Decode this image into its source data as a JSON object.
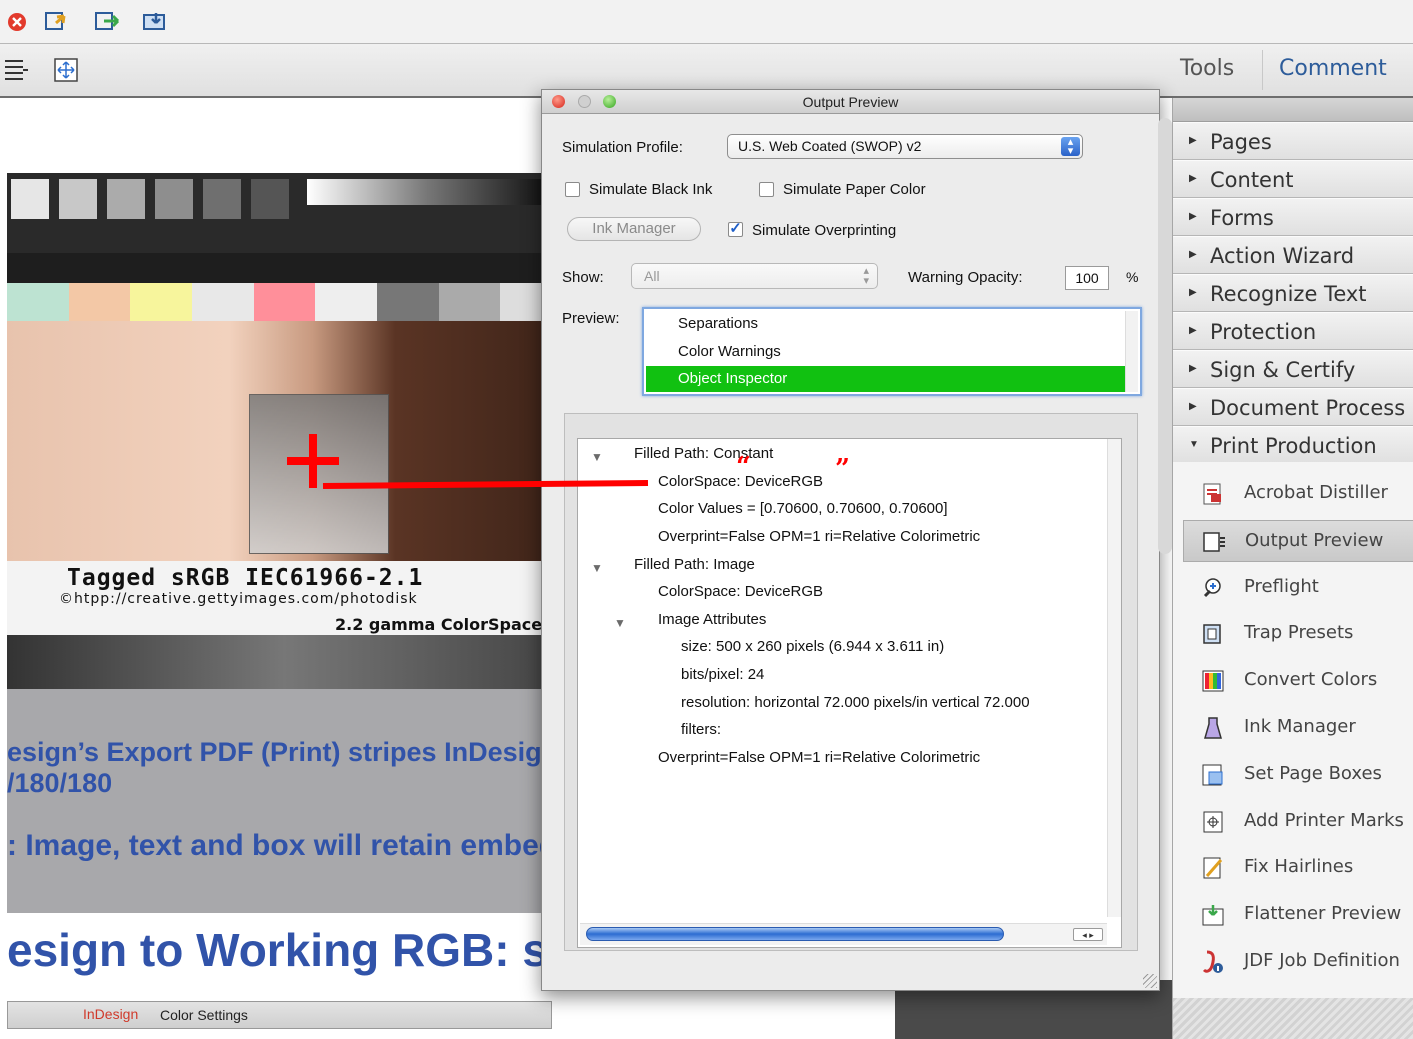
{
  "toolbar": {
    "icons": [
      "close-icon",
      "export-icon",
      "share-icon",
      "import-icon",
      "fit-width-icon",
      "fit-page-icon"
    ]
  },
  "tabs": {
    "tools": "Tools",
    "comment": "Comment"
  },
  "document": {
    "image_label_1": "Tagged sRGB IEC61966-2.1",
    "image_label_2": "©htpp://creative.gettyimages.com/photodisk",
    "image_label_3": "2.2 gamma ColorSpace",
    "line1": "esign’s Export PDF (Print) stripes InDesign’s",
    "line2": "/180/180",
    "line3": ": Image, text and box will retain embed",
    "heading": "esign to Working RGB: sR",
    "inset_logo": "InDesign",
    "inset_title": "Color Settings"
  },
  "annotation": {
    "quote_open": "“",
    "quote_close": "”",
    "color": "#ff0000"
  },
  "dialog": {
    "title": "Output Preview",
    "simulation_profile_label": "Simulation Profile:",
    "simulation_profile_value": "U.S. Web Coated (SWOP) v2",
    "simulate_black_ink": "Simulate Black Ink",
    "simulate_paper_color": "Simulate Paper Color",
    "ink_manager": "Ink Manager",
    "simulate_overprinting": "Simulate Overprinting",
    "show_label": "Show:",
    "show_value": "All",
    "warning_opacity_label": "Warning Opacity:",
    "warning_opacity_value": "100",
    "percent": "%",
    "preview_label": "Preview:",
    "preview_items": [
      "Separations",
      "Color Warnings",
      "Object Inspector"
    ],
    "selected_preview": "Object Inspector",
    "inspector": {
      "l1": "Filled Path: Constant",
      "l2": "ColorSpace: DeviceRGB",
      "l3": "Color Values = [0.70600, 0.70600, 0.70600]",
      "l4": "Overprint=False OPM=1 ri=Relative Colorimetric",
      "l5": "Filled Path: Image",
      "l6": "ColorSpace: DeviceRGB",
      "l7": "Image Attributes",
      "l8": "size: 500 x 260 pixels (6.944 x 3.611 in)",
      "l9": "bits/pixel: 24",
      "l10": "resolution: horizontal 72.000 pixels/in vertical 72.000",
      "l11": "filters:",
      "l12": "Overprint=False OPM=1 ri=Relative Colorimetric"
    }
  },
  "panel": {
    "sections": [
      "Pages",
      "Content",
      "Forms",
      "Action Wizard",
      "Recognize Text",
      "Protection",
      "Sign & Certify",
      "Document Process",
      "Print Production"
    ],
    "tools": [
      "Acrobat Distiller",
      "Output Preview",
      "Preflight",
      "Trap Presets",
      "Convert Colors",
      "Ink Manager",
      "Set Page Boxes",
      "Add Printer Marks",
      "Fix Hairlines",
      "Flattener Preview",
      "JDF Job Definition"
    ],
    "selected_tool": "Output Preview"
  }
}
